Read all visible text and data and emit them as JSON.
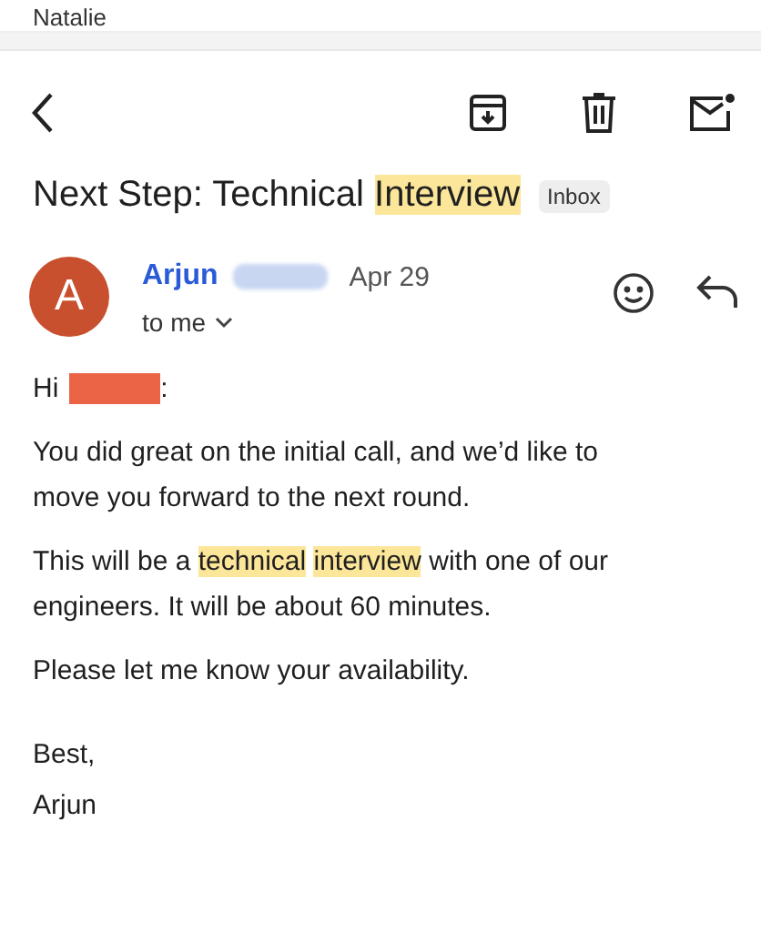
{
  "previous_sender": "Natalie",
  "toolbar": {
    "back": true,
    "archive": true,
    "delete": true,
    "mark_unread": true
  },
  "subject": {
    "segments": [
      {
        "text": "Next Step: Technical ",
        "highlighted": false
      },
      {
        "text": "Interview",
        "highlighted": true
      }
    ],
    "label": "Inbox"
  },
  "message": {
    "avatar_letter": "A",
    "sender": "Arjun",
    "surname_redacted": true,
    "date": "Apr 29",
    "recipient": "to me",
    "greeting": {
      "text": "Hi",
      "name_redacted": true,
      "punctuation": ":"
    },
    "paragraphs": [
      [
        {
          "text": "You did great on the initial call, and we’d like to move you forward to the next round.",
          "highlighted": false
        }
      ],
      [
        {
          "text": "This will be a ",
          "highlighted": false
        },
        {
          "text": "technical",
          "highlighted": true,
          "space_after": true
        },
        {
          "text": "interview",
          "highlighted": true
        },
        {
          "text": " with one of our engineers. It will be about 60 minutes.",
          "highlighted": false
        }
      ],
      [
        {
          "text": "Please let me know your availability.",
          "highlighted": false
        }
      ]
    ],
    "signoff": [
      "Best,",
      "Arjun"
    ]
  }
}
